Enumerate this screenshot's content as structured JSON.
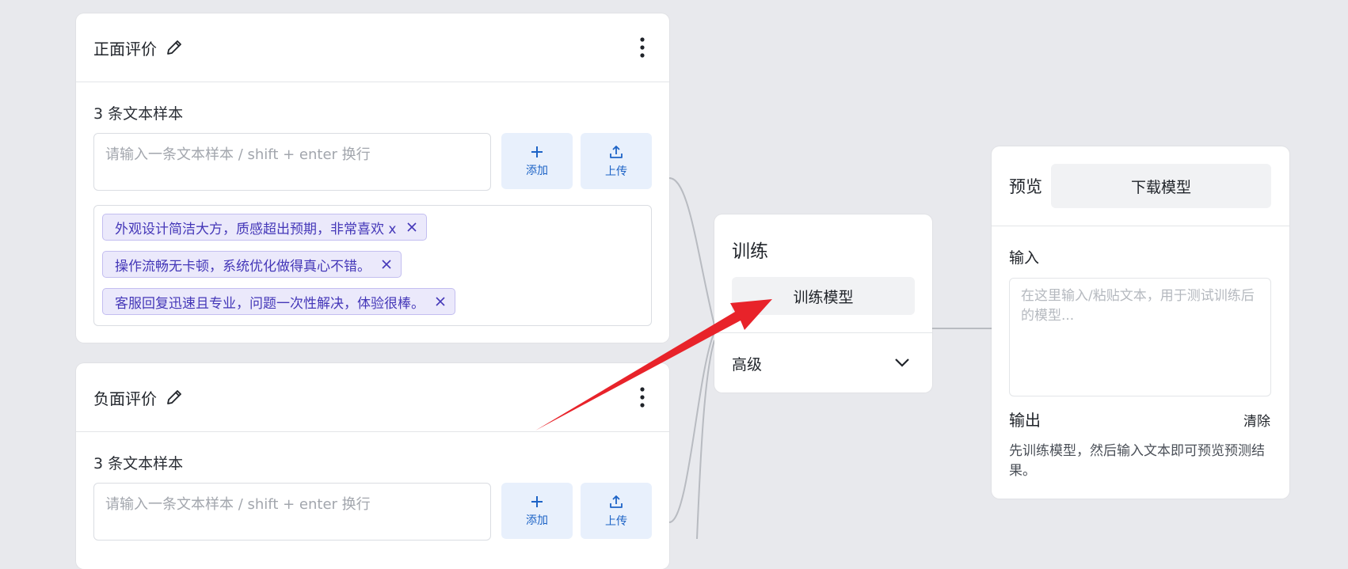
{
  "classes": [
    {
      "title": "正面评价",
      "sample_count": "3 条文本样本",
      "input_placeholder": "请输入一条文本样本 / shift + enter 换行",
      "add_label": "添加",
      "upload_label": "上传",
      "samples": [
        "外观设计简洁大方，质感超出预期，非常喜欢 x",
        "操作流畅无卡顿，系统优化做得真心不错。",
        "客服回复迅速且专业，问题一次性解决，体验很棒。"
      ]
    },
    {
      "title": "负面评价",
      "sample_count": "3 条文本样本",
      "input_placeholder": "请输入一条文本样本 / shift + enter 换行",
      "add_label": "添加",
      "upload_label": "上传"
    }
  ],
  "train": {
    "title": "训练",
    "button_label": "训练模型",
    "advanced_label": "高级"
  },
  "preview": {
    "title": "预览",
    "download_label": "下载模型",
    "input_label": "输入",
    "input_placeholder": "在这里输入/粘贴文本，用于测试训练后的模型...",
    "output_label": "输出",
    "clear_label": "清除",
    "output_hint": "先训练模型，然后输入文本即可预览预测结果。"
  },
  "colors": {
    "background": "#e8e9ed",
    "accent_blue": "#1d63c6",
    "chip_bg": "#ebe9fb",
    "chip_text": "#4437b8",
    "annotation_arrow": "#e8232a"
  },
  "icons": {
    "edit": "pencil-icon",
    "menu": "more-vertical-icon",
    "add": "plus-icon",
    "upload": "upload-icon",
    "remove": "close-icon",
    "expand": "chevron-down-icon"
  }
}
